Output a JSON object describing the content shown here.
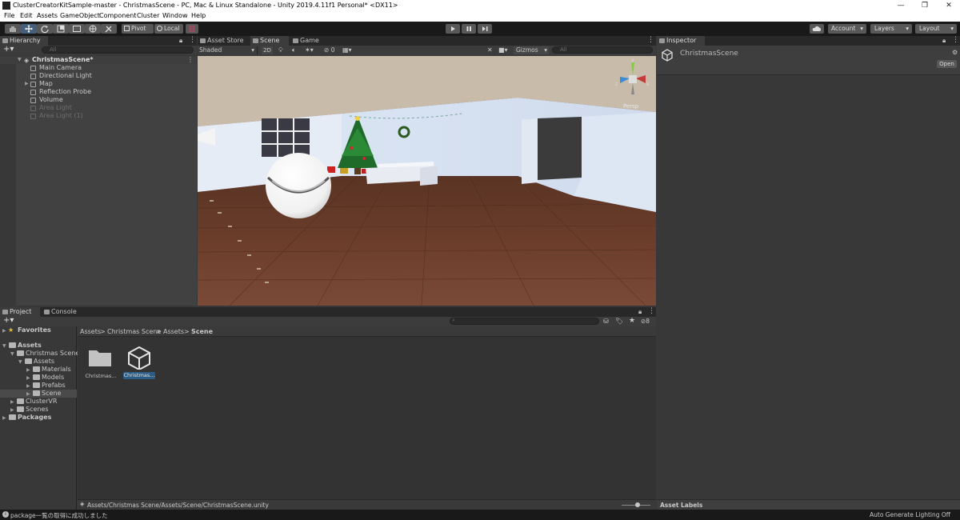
{
  "window": {
    "title": "ClusterCreatorKitSample-master - ChristmasScene - PC, Mac & Linux Standalone - Unity 2019.4.11f1 Personal* <DX11>",
    "controls": [
      "—",
      "❐",
      "✕"
    ]
  },
  "menu": [
    "File",
    "Edit",
    "Assets",
    "GameObject",
    "Component",
    "Cluster",
    "Window",
    "Help"
  ],
  "toolbar": {
    "pivot": "Pivot",
    "local": "Local",
    "account": "Account",
    "layers": "Layers",
    "layout": "Layout"
  },
  "hierarchy": {
    "tab": "Hierarchy",
    "search_placeholder": "All",
    "scene": "ChristmasScene*",
    "items": [
      {
        "label": "Main Camera",
        "dim": false,
        "expandable": false
      },
      {
        "label": "Directional Light",
        "dim": false,
        "expandable": false
      },
      {
        "label": "Map",
        "dim": false,
        "expandable": true
      },
      {
        "label": "Reflection Probe",
        "dim": false,
        "expandable": false
      },
      {
        "label": "Volume",
        "dim": false,
        "expandable": false
      },
      {
        "label": "Area Light",
        "dim": true,
        "expandable": false
      },
      {
        "label": "Area Light (1)",
        "dim": true,
        "expandable": false
      }
    ]
  },
  "scene_view": {
    "tabs": [
      "Asset Store",
      "Scene",
      "Game"
    ],
    "shading": "Shaded",
    "mode_2d": "2D",
    "hidden_count": "0",
    "gizmos": "Gizmos",
    "search_placeholder": "All",
    "projection": "Persp",
    "axis_labels": [
      "y",
      "x",
      "z"
    ]
  },
  "inspector": {
    "tab": "Inspector",
    "object": "ChristmasScene",
    "open_button": "Open",
    "asset_labels": "Asset Labels"
  },
  "project": {
    "tabs": [
      "Project",
      "Console"
    ],
    "hidden_count": "8",
    "favorites": "Favorites",
    "tree": [
      {
        "label": "Assets",
        "bold": true,
        "depth": 0
      },
      {
        "label": "Christmas Scene",
        "bold": false,
        "depth": 1
      },
      {
        "label": "Assets",
        "bold": false,
        "depth": 2
      },
      {
        "label": "Materials",
        "bold": false,
        "depth": 3
      },
      {
        "label": "Models",
        "bold": false,
        "depth": 3
      },
      {
        "label": "Prefabs",
        "bold": false,
        "depth": 3
      },
      {
        "label": "Scene",
        "bold": false,
        "depth": 3,
        "selected": true
      },
      {
        "label": "ClusterVR",
        "bold": false,
        "depth": 1
      },
      {
        "label": "Scenes",
        "bold": false,
        "depth": 1
      },
      {
        "label": "Packages",
        "bold": true,
        "depth": 0
      }
    ],
    "breadcrumb": [
      "Assets",
      "Christmas Scene",
      "Assets",
      "Scene"
    ],
    "assets": [
      {
        "label": "Christmas...",
        "kind": "folder",
        "selected": false
      },
      {
        "label": "Christmas...",
        "kind": "unity-scene",
        "selected": true
      }
    ],
    "path": "Assets/Christmas Scene/Assets/Scene/ChristmasScene.unity",
    "zoom_level": 0.55
  },
  "status": {
    "message": "package一覧の取得に成功しました",
    "right": "Auto Generate Lighting Off"
  },
  "colors": {
    "toolbar_bg": "#191919",
    "panel_bg": "#383838",
    "selection": "#2c5d87",
    "active_tool": "#46607c"
  }
}
